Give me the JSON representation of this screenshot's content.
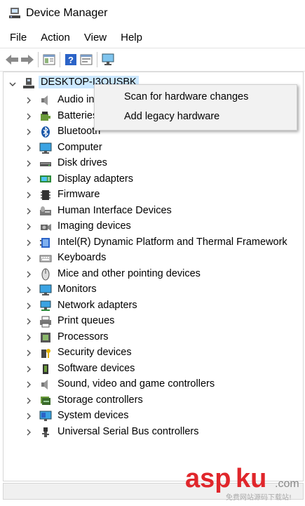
{
  "window": {
    "title": "Device Manager"
  },
  "menu": [
    "File",
    "Action",
    "View",
    "Help"
  ],
  "toolbar": [
    "back-icon",
    "forward-icon",
    "properties-icon",
    "help-icon",
    "update-driver-icon",
    "scan-monitor-icon"
  ],
  "tree": {
    "root": "DESKTOP-I3OUSBK",
    "items": [
      "Audio inputs and outputs",
      "Batteries",
      "Bluetooth",
      "Computer",
      "Disk drives",
      "Display adapters",
      "Firmware",
      "Human Interface Devices",
      "Imaging devices",
      "Intel(R) Dynamic Platform and Thermal Framework",
      "Keyboards",
      "Mice and other pointing devices",
      "Monitors",
      "Network adapters",
      "Print queues",
      "Processors",
      "Security devices",
      "Software devices",
      "Sound, video and game controllers",
      "Storage controllers",
      "System devices",
      "Universal Serial Bus controllers"
    ],
    "icons": [
      "speaker-icon",
      "battery-icon",
      "bluetooth-icon",
      "computer-icon",
      "disk-drive-icon",
      "display-adapter-icon",
      "firmware-icon",
      "hid-icon",
      "camera-icon",
      "chip-icon",
      "keyboard-icon",
      "mouse-icon",
      "monitor-icon",
      "network-icon",
      "printer-icon",
      "processor-icon",
      "security-icon",
      "software-icon",
      "sound-icon",
      "storage-icon",
      "system-icon",
      "usb-icon"
    ]
  },
  "context_menu": {
    "scan": "Scan for hardware changes",
    "add_legacy": "Add legacy hardware"
  },
  "watermark": {
    "brand": "aspku",
    "suffix": ".com",
    "tagline": "免费网站源码下载站!"
  },
  "colors": {
    "selection": "#cce8ff",
    "accent": "#0078d7",
    "brand_red": "#e0262b"
  }
}
